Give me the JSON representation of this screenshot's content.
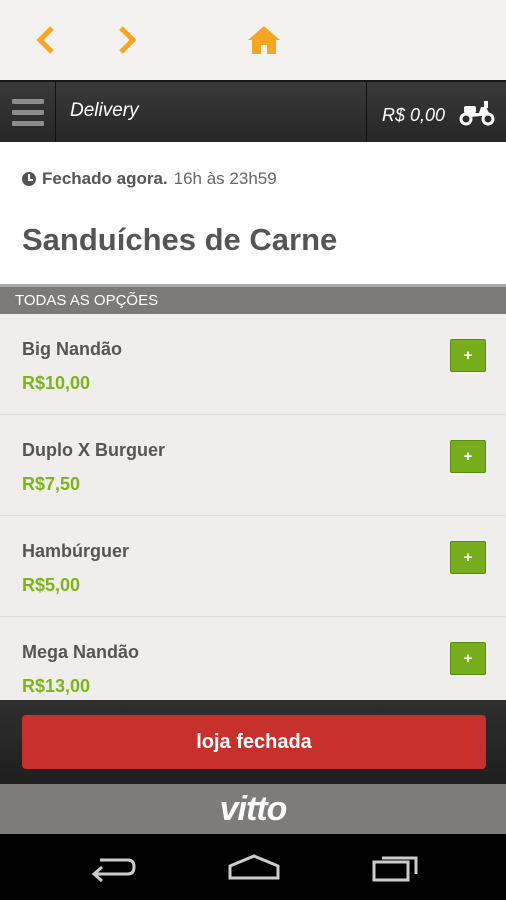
{
  "browser": {
    "back_icon": "chevron-left-icon",
    "forward_icon": "chevron-right-icon",
    "home_icon": "home-icon",
    "accent_color": "#f5a623"
  },
  "header": {
    "menu_icon": "hamburger-menu-icon",
    "title": "Delivery",
    "cart_total": "R$ 0,00",
    "cart_icon": "scooter-icon"
  },
  "store": {
    "status": "Fechado agora.",
    "hours": "16h às 23h59",
    "category": "Sanduíches de Carne"
  },
  "section": {
    "label": "TODAS AS OPÇÕES"
  },
  "items": [
    {
      "name": "Big Nandão",
      "price": "R$10,00",
      "add_label": "+"
    },
    {
      "name": "Duplo X Burguer",
      "price": "R$7,50",
      "add_label": "+"
    },
    {
      "name": "Hambúrguer",
      "price": "R$5,00",
      "add_label": "+"
    },
    {
      "name": "Mega Nandão",
      "price": "R$13,00",
      "add_label": "+"
    }
  ],
  "footer": {
    "button_label": "loja fechada",
    "button_color": "#c8302e"
  },
  "brand": {
    "logo": "vitto"
  },
  "system_nav": {
    "back_icon": "android-back-icon",
    "home_icon": "android-home-icon",
    "recents_icon": "android-recents-icon"
  },
  "colors": {
    "price_green": "#7cb519",
    "add_button_green": "#77ad1c"
  }
}
